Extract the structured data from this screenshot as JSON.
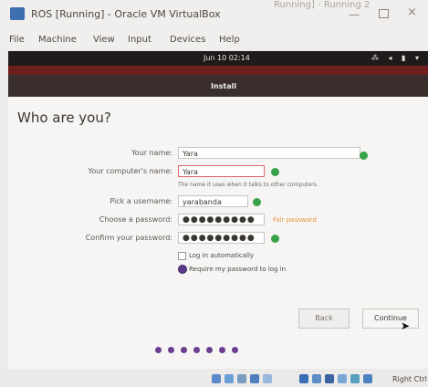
{
  "window": {
    "title": "ROS [Running] - Oracle VM VirtualBox",
    "title_ghost": "Running] - Running 2",
    "minimize": "—",
    "close": "×"
  },
  "menubar": [
    "File",
    "Machine",
    "View",
    "Input",
    "Devices",
    "Help"
  ],
  "guest": {
    "clock": "Jun 10  02:14",
    "tray": "⁂ ◂ ▮ ▾",
    "installer_title": "Install",
    "page_title": "Who are you?",
    "form": {
      "your_name_label": "Your name:",
      "your_name_value": "Yara",
      "computer_name_label": "Your computer's name:",
      "computer_name_value": "Yara",
      "computer_hint": "The name it uses when it talks to other computers.",
      "username_label": "Pick a username:",
      "username_value": "yarabanda",
      "password_label": "Choose a password:",
      "password_value": "●●●●●●●●●",
      "password_strength": "Fair password",
      "confirm_label": "Confirm your password:",
      "confirm_value": "●●●●●●●●●",
      "login_auto": "Log in automatically",
      "login_require": "Require my password to log in"
    },
    "buttons": {
      "back": "Back",
      "continue": "Continue"
    },
    "progress_dots": 7
  },
  "statusbar": {
    "right_ctrl": "Right Ctrl"
  }
}
